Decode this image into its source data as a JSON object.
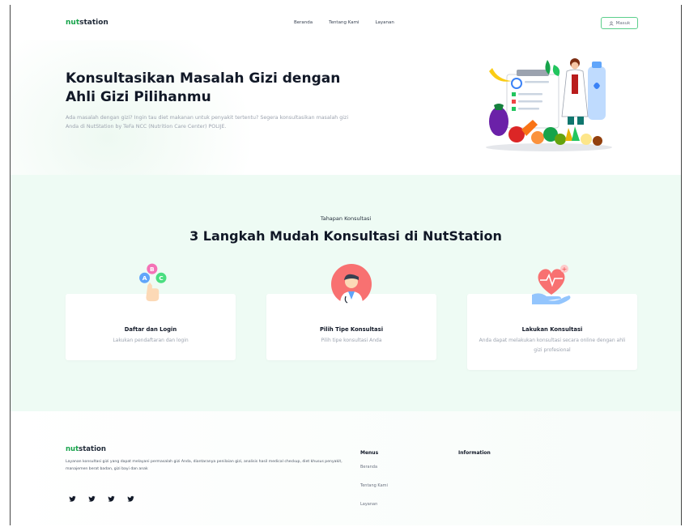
{
  "header": {
    "brand": {
      "prefix": "nut",
      "suffix": "station"
    },
    "nav": [
      "Beranda",
      "Tentang Kami",
      "Layanan"
    ],
    "login_label": "Masuk"
  },
  "hero": {
    "title": "Konsultasikan Masalah Gizi dengan Ahli Gizi Pilihanmu",
    "description": "Ada masalah dengan gizi? Ingin tau diet makanan untuk penyakit tertentu? Segera konsultasikan masalah gizi Anda di NutStation by TeFa NCC (Nutrition Care Center) POLIJE."
  },
  "steps": {
    "subtitle": "Tahapan Konsultasi",
    "title": "3 Langkah Mudah Konsultasi di NutStation",
    "cards": [
      {
        "title": "Daftar dan Login",
        "desc": "Lakukan pendaftaran dan login"
      },
      {
        "title": "Pilih Tipe Konsultasi",
        "desc": "Pilih tipe konsultasi Anda"
      },
      {
        "title": "Lakukan Konsultasi",
        "desc": "Anda dapat melakukan konsultasi secara online dengan ahli gizi profesional"
      }
    ]
  },
  "footer": {
    "brand": {
      "prefix": "nut",
      "suffix": "station"
    },
    "description": "Layanan konsultasi gizi yang dapat melayani permasalah gizi Anda, diantaranya penilaian gizi, analisis hasil medical checkup, diet khusus penyakit, manajemen berat badan, gizi bayi dan anak",
    "menus_heading": "Menus",
    "menus": [
      "Beranda",
      "Tentang Kami",
      "Layanan"
    ],
    "information_heading": "Information"
  },
  "colors": {
    "accent": "#16a34a",
    "section_bg": "#eefbf4",
    "button_border": "#5ccf8c"
  },
  "icons": [
    "user-icon",
    "twitter-icon",
    "abc-bubbles-icon",
    "doctor-icon",
    "heart-hand-icon"
  ]
}
